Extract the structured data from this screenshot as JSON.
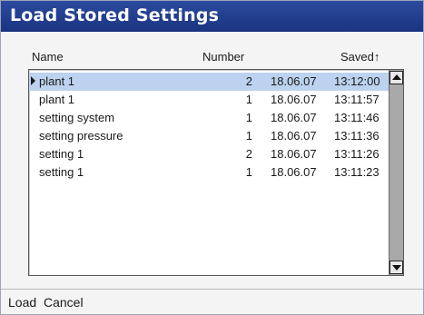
{
  "window": {
    "title": "Load Stored Settings"
  },
  "columns": {
    "name": "Name",
    "number": "Number",
    "saved": "Saved↑"
  },
  "rows": [
    {
      "name": "plant 1",
      "number": "2",
      "date": "18.06.07",
      "time": "13:12:00",
      "selected": true
    },
    {
      "name": "plant 1",
      "number": "1",
      "date": "18.06.07",
      "time": "13:11:57",
      "selected": false
    },
    {
      "name": "setting system",
      "number": "1",
      "date": "18.06.07",
      "time": "13:11:46",
      "selected": false
    },
    {
      "name": "setting pressure",
      "number": "1",
      "date": "18.06.07",
      "time": "13:11:36",
      "selected": false
    },
    {
      "name": "setting 1",
      "number": "2",
      "date": "18.06.07",
      "time": "13:11:26",
      "selected": false
    },
    {
      "name": "setting 1",
      "number": "1",
      "date": "18.06.07",
      "time": "13:11:23",
      "selected": false
    }
  ],
  "footer": {
    "load_label": "Load",
    "cancel_label": "Cancel"
  },
  "colors": {
    "title_bar": "#1f3c8f",
    "selection": "#bcd2ee"
  }
}
